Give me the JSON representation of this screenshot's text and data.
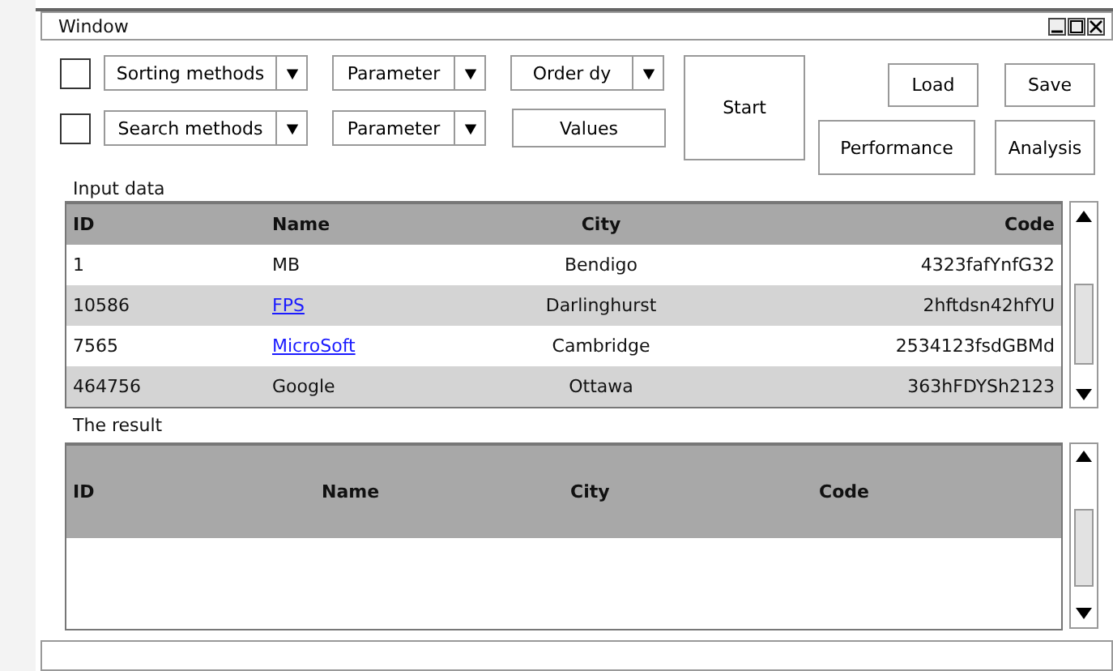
{
  "window": {
    "title": "Window"
  },
  "controls": {
    "rows": [
      [
        {
          "kind": "checkbox",
          "checked": false
        },
        {
          "kind": "dropdown",
          "label": "Sorting methods"
        },
        {
          "kind": "dropdown",
          "label": "Parameter"
        },
        {
          "kind": "dropdown",
          "label": "Order dy"
        }
      ],
      [
        {
          "kind": "checkbox",
          "checked": false
        },
        {
          "kind": "dropdown",
          "label": "Search methods"
        },
        {
          "kind": "dropdown",
          "label": "Parameter"
        },
        {
          "kind": "button",
          "label": "Values"
        }
      ]
    ],
    "start_button": "Start",
    "buttons_top": [
      "Load",
      "Save"
    ],
    "buttons_bottom": [
      "Performance",
      "Analysis"
    ]
  },
  "input_data": {
    "label": "Input data",
    "columns": [
      "ID",
      "Name",
      "City",
      "Code"
    ],
    "rows": [
      {
        "id": "1",
        "name": "MB",
        "link": false,
        "city": "Bendigo",
        "code": "4323fafYnfG32"
      },
      {
        "id": "10586",
        "name": "FPS",
        "link": true,
        "city": "Darlinghurst",
        "code": "2hftdsn42hfYU"
      },
      {
        "id": "7565",
        "name": "MicroSoft",
        "link": true,
        "city": "Cambridge",
        "code": "2534123fsdGBMd"
      },
      {
        "id": "464756",
        "name": "Google",
        "link": false,
        "city": "Ottawa",
        "code": "363hFDYSh2123"
      }
    ]
  },
  "result": {
    "label": "The result",
    "columns": [
      "ID",
      "Name",
      "City",
      "Code"
    ]
  }
}
